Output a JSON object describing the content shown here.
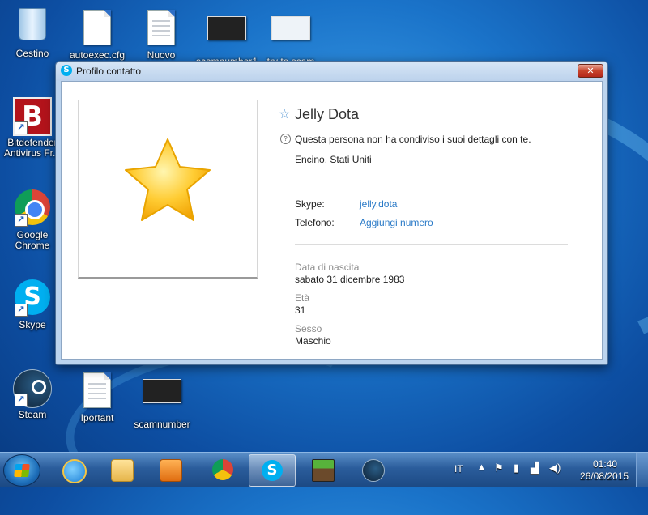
{
  "desktop": {
    "icons": [
      {
        "label": "Cestino",
        "icon": "recycle-bin-icon"
      },
      {
        "label": "autoexec.cfg",
        "icon": "text-file-icon"
      },
      {
        "label": "Nuovo",
        "icon": "text-file-icon"
      },
      {
        "label": "scamnumber1",
        "icon": "image-thumbnail-icon"
      },
      {
        "label": "try to scam",
        "icon": "image-thumbnail-icon"
      },
      {
        "label": "Bitdefender Antivirus Fr...",
        "icon": "bitdefender-icon"
      },
      {
        "label": "Google Chrome",
        "icon": "chrome-icon"
      },
      {
        "label": "Skype",
        "icon": "skype-icon"
      },
      {
        "label": "Steam",
        "icon": "steam-icon"
      },
      {
        "label": "Iportant",
        "icon": "text-file-icon"
      },
      {
        "label": "scamnumber",
        "icon": "image-thumbnail-icon"
      }
    ]
  },
  "window": {
    "title": "Profilo contatto",
    "close_glyph": "✕",
    "profile": {
      "name": "Jelly Dota",
      "privacy_note": "Questa persona non ha condiviso i suoi dettagli con te.",
      "location": "Encino, Stati Uniti",
      "skype_label": "Skype:",
      "skype_value": "jelly.dota",
      "phone_label": "Telefono:",
      "phone_value": "Aggiungi numero",
      "birth_label": "Data di nascita",
      "birth_value": "sabato 31 dicembre 1983",
      "age_label": "Età",
      "age_value": "31",
      "sex_label": "Sesso",
      "sex_value": "Maschio"
    }
  },
  "taskbar": {
    "apps": [
      "internet-explorer-icon",
      "file-explorer-icon",
      "media-player-icon",
      "chrome-icon",
      "skype-icon",
      "minecraft-icon",
      "steam-icon"
    ],
    "active_app": "skype-icon",
    "language": "IT",
    "time": "01:40",
    "date": "26/08/2015"
  }
}
